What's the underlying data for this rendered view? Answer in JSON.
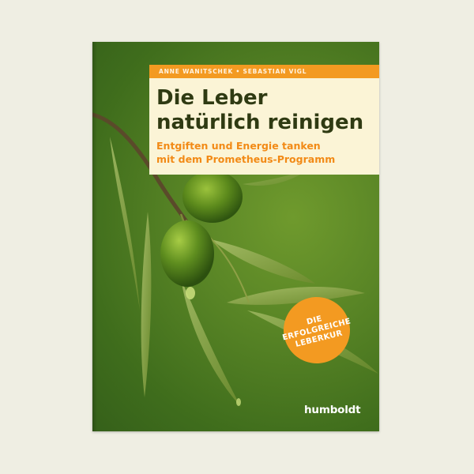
{
  "book": {
    "authors": "ANNE WANITSCHEK • SEBASTIAN VIGL",
    "title_line1": "Die Leber",
    "title_line2": "natürlich reinigen",
    "subtitle_line1": "Entgiften und Energie tanken",
    "subtitle_line2": "mit dem Prometheus-Programm",
    "badge_line1": "DIE",
    "badge_line2": "ERFOLGREICHE",
    "badge_line3": "LEBERKUR",
    "publisher": "humboldt"
  },
  "colors": {
    "background": "#efeee3",
    "cover_green": "#4f7d22",
    "accent_orange": "#f39a21",
    "title_panel": "#fbf4d6",
    "title_text": "#2f3a12"
  }
}
